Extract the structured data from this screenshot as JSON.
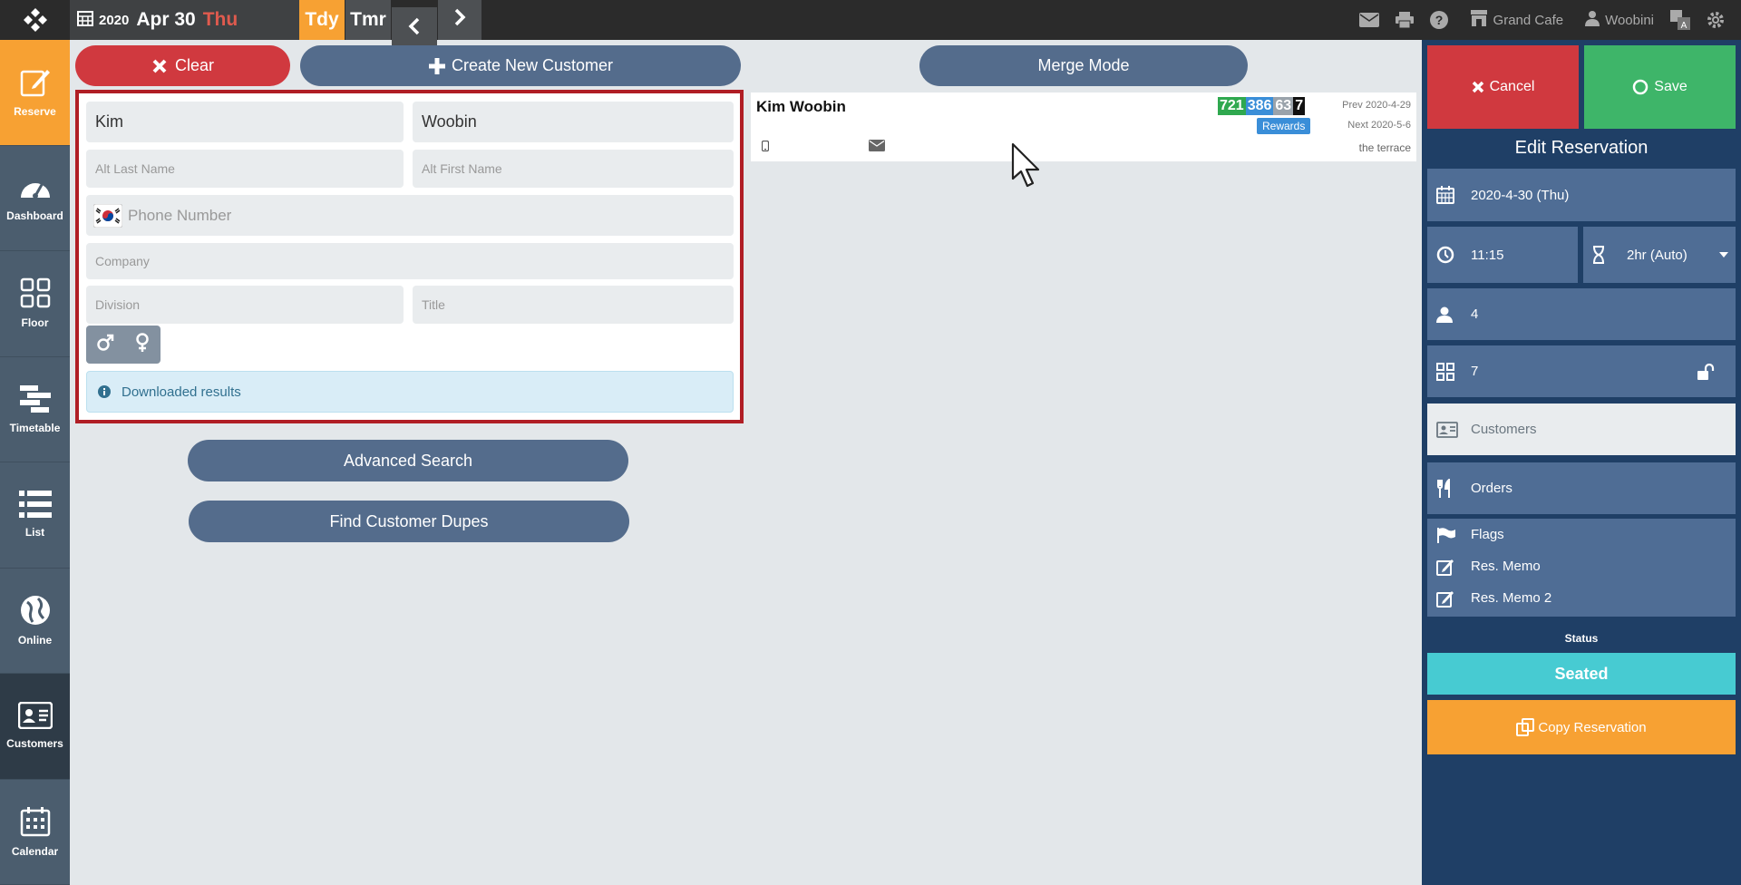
{
  "topbar": {
    "year": "2020",
    "month_day": "Apr 30",
    "weekday": "Thu",
    "today_label": "Tdy",
    "tomorrow_label": "Tmr",
    "venue": "Grand Cafe",
    "user": "Woobini",
    "icons": [
      "envelope-icon",
      "print-icon",
      "help-icon",
      "store-icon",
      "user-tie-icon",
      "translate-icon",
      "gear-icon"
    ]
  },
  "sidebar": {
    "items": [
      {
        "label": "Reserve",
        "icon": "edit-icon"
      },
      {
        "label": "Dashboard",
        "icon": "gauge-icon"
      },
      {
        "label": "Floor",
        "icon": "grid-icon"
      },
      {
        "label": "Timetable",
        "icon": "timeline-icon"
      },
      {
        "label": "List",
        "icon": "list-icon"
      },
      {
        "label": "Online",
        "icon": "globe-icon"
      },
      {
        "label": "Customers",
        "icon": "contact-card-icon"
      },
      {
        "label": "Calendar",
        "icon": "calendar-icon"
      }
    ]
  },
  "actions": {
    "clear_label": "Clear",
    "create_label": "Create New Customer",
    "merge_label": "Merge Mode",
    "advanced_label": "Advanced Search",
    "dupes_label": "Find Customer Dupes"
  },
  "form": {
    "last_name": "Kim",
    "first_name": "Woobin",
    "alt_last_placeholder": "Alt Last Name",
    "alt_first_placeholder": "Alt First Name",
    "phone_placeholder": "Phone Number",
    "company_placeholder": "Company",
    "division_placeholder": "Division",
    "title_placeholder": "Title",
    "info_text": "Downloaded results"
  },
  "result": {
    "name": "Kim Woobin",
    "badges": [
      {
        "value": "721",
        "color": "#2fa84f"
      },
      {
        "value": "386",
        "color": "#3a8ed8"
      },
      {
        "value": "63",
        "color": "#9aa3ab"
      },
      {
        "value": "7",
        "color": "#111111"
      }
    ],
    "rewards_label": "Rewards",
    "prev_visit": "Prev 2020-4-29",
    "next_visit": "Next 2020-5-6",
    "area": "the terrace"
  },
  "reservation": {
    "cancel_label": "Cancel",
    "save_label": "Save",
    "title": "Edit Reservation",
    "date": "2020-4-30 (Thu)",
    "time": "11:15",
    "duration": "2hr (Auto)",
    "party_size": "4",
    "table": "7",
    "customers_label": "Customers",
    "orders_label": "Orders",
    "flags_label": "Flags",
    "memo_label": "Res. Memo",
    "memo2_label": "Res. Memo 2",
    "status_label": "Status",
    "status_value": "Seated",
    "copy_label": "Copy Reservation"
  },
  "colors": {
    "accent_orange": "#f7a133",
    "danger_red": "#d0393f",
    "success_green": "#3eb569",
    "panel_navy": "#1f3f66",
    "seated_teal": "#47cbd2"
  }
}
